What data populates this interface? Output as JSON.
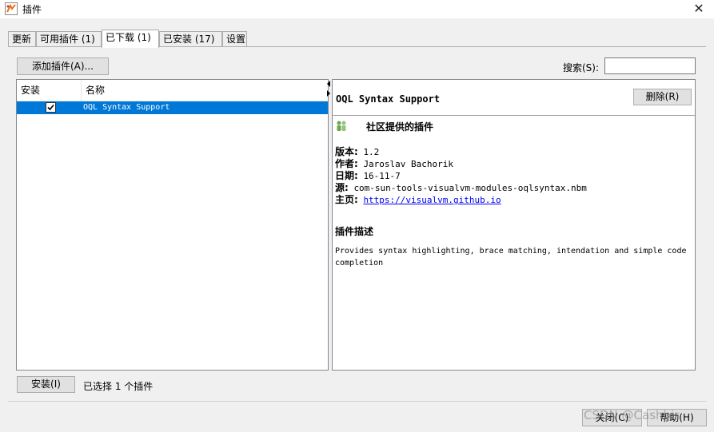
{
  "window": {
    "title": "插件",
    "close_glyph": "✕"
  },
  "tabs": [
    {
      "label": "更新",
      "active": false
    },
    {
      "label": "可用插件 (1)",
      "active": false
    },
    {
      "label": "已下载 (1)",
      "active": true
    },
    {
      "label": "已安装 (17)",
      "active": false
    },
    {
      "label": "设置",
      "active": false
    }
  ],
  "toolbar": {
    "add_plugin_label": "添加插件(A)...",
    "search_label": "搜索(S):",
    "search_value": ""
  },
  "plugin_table": {
    "columns": [
      "安装",
      "名称"
    ],
    "rows": [
      {
        "install": true,
        "name": "OQL Syntax Support",
        "selected": true
      }
    ]
  },
  "details": {
    "title": "OQL Syntax Support",
    "delete_label": "删除(R)",
    "community_label": "社区提供的插件",
    "version_label": "版本:",
    "version_value": "1.2",
    "author_label": "作者:",
    "author_value": "Jaroslav Bachorik",
    "date_label": "日期:",
    "date_value": "16-11-7",
    "source_label": "源:",
    "source_value": "com-sun-tools-visualvm-modules-oqlsyntax.nbm",
    "homepage_label": "主页:",
    "homepage_value": "https://visualvm.github.io",
    "desc_heading": "插件描述",
    "desc_text": "Provides syntax highlighting, brace matching, intendation and simple code completion"
  },
  "footer": {
    "install_label": "安装(I)",
    "status_text": "已选择 1 个插件",
    "close_label": "关闭(C)",
    "help_label": "帮助(H)",
    "watermark": "CSDN @Cashbir"
  },
  "colors": {
    "selection": "#0078d7",
    "link": "#0000ee"
  },
  "icons": {
    "app": "visualvm-app-icon",
    "community": "community-people-icon",
    "checkbox": "checkbox-checked-icon"
  }
}
